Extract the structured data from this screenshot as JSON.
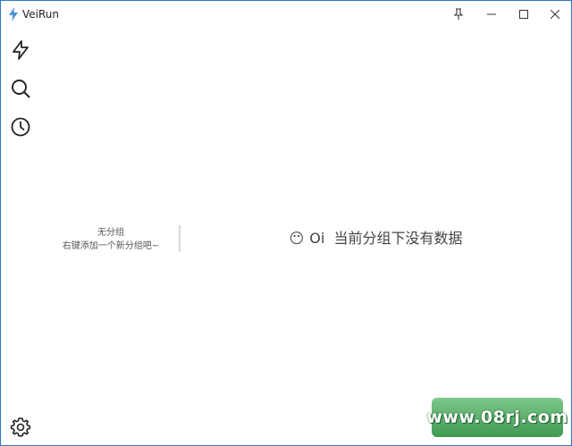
{
  "window": {
    "title": "VeiRun",
    "accent_color": "#2b78c8",
    "icons": {
      "app": "lightning-icon",
      "pin": "pin-icon",
      "minimize": "minimize-icon",
      "maximize": "maximize-icon",
      "close": "close-icon"
    }
  },
  "nav": {
    "items": [
      {
        "icon": "lightning-icon",
        "name": "run"
      },
      {
        "icon": "search-icon",
        "name": "search"
      },
      {
        "icon": "clock-icon",
        "name": "history"
      },
      {
        "icon": "gear-icon",
        "name": "settings"
      }
    ]
  },
  "group_panel": {
    "title": "无分组",
    "hint": "右键添加一个新分组吧~"
  },
  "empty_state": {
    "emoji": "😶",
    "prefix": "Oi",
    "message": "当前分组下没有数据"
  },
  "watermark": {
    "text": "www.08rj.com"
  }
}
